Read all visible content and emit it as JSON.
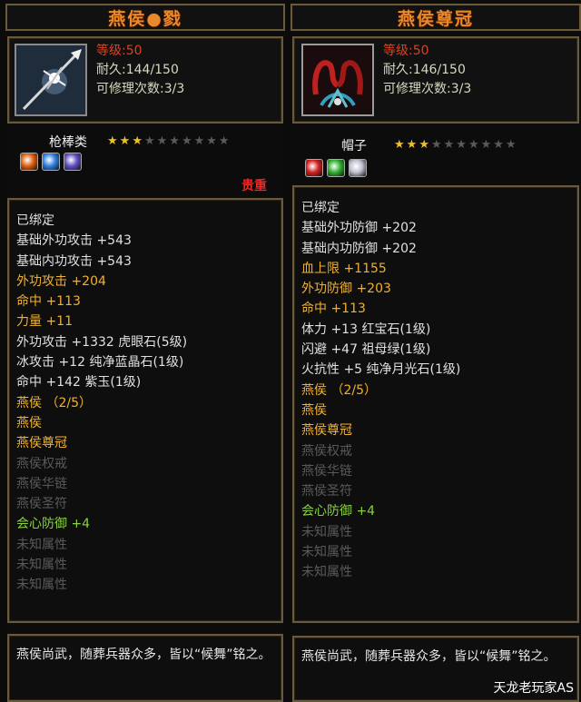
{
  "left": {
    "title": "燕侯●戮",
    "level": "等级:50",
    "durability": "耐久:144/150",
    "repair": "可修理次数:3/3",
    "type": "枪棒类",
    "stars_on": 3,
    "stars_total": 10,
    "gems": [
      {
        "name": "ruby-gem-icon",
        "color": "#e06010"
      },
      {
        "name": "sapphire-gem-icon",
        "color": "#3080e0"
      },
      {
        "name": "amethyst-gem-icon",
        "color": "#6050c0"
      }
    ],
    "rarity": "贵重",
    "attrs": [
      {
        "text": "已绑定",
        "color": "white"
      },
      {
        "text": "基础外功攻击 +543",
        "color": "white"
      },
      {
        "text": "基础内功攻击 +543",
        "color": "white"
      },
      {
        "text": "外功攻击 +204",
        "color": "orange"
      },
      {
        "text": "命中 +113",
        "color": "orange"
      },
      {
        "text": "力量 +11",
        "color": "orange"
      },
      {
        "text": "外功攻击 +1332 虎眼石(5级)",
        "color": "white"
      },
      {
        "text": "冰攻击 +12 纯净蓝晶石(1级)",
        "color": "white"
      },
      {
        "text": "命中 +142 紫玉(1级)",
        "color": "white"
      },
      {
        "text": "燕侯 （2/5）",
        "color": "orange"
      },
      {
        "text": "燕侯",
        "color": "orange"
      },
      {
        "text": "燕侯尊冠",
        "color": "orange"
      },
      {
        "text": "燕侯权戒",
        "color": "gray"
      },
      {
        "text": "燕侯华链",
        "color": "gray"
      },
      {
        "text": "燕侯圣符",
        "color": "gray"
      },
      {
        "text": "会心防御 +4",
        "color": "green"
      },
      {
        "text": "未知属性",
        "color": "gray"
      },
      {
        "text": "未知属性",
        "color": "gray"
      },
      {
        "text": "未知属性",
        "color": "gray"
      }
    ],
    "description": "燕侯尚武，随葬兵器众多，皆以“候舞”铭之。"
  },
  "right": {
    "title": "燕侯尊冠",
    "level": "等级:50",
    "durability": "耐久:146/150",
    "repair": "可修理次数:3/3",
    "type": "帽子",
    "stars_on": 3,
    "stars_total": 10,
    "gems": [
      {
        "name": "ruby-gem-icon",
        "color": "#d02020"
      },
      {
        "name": "emerald-gem-icon",
        "color": "#30b030"
      },
      {
        "name": "moonstone-gem-icon",
        "color": "#c0c0d0"
      }
    ],
    "attrs": [
      {
        "text": "已绑定",
        "color": "white"
      },
      {
        "text": "基础外功防御 +202",
        "color": "white"
      },
      {
        "text": "基础内功防御 +202",
        "color": "white"
      },
      {
        "text": "血上限 +1155",
        "color": "orange"
      },
      {
        "text": "外功防御 +203",
        "color": "orange"
      },
      {
        "text": "命中 +113",
        "color": "orange"
      },
      {
        "text": "体力 +13 红宝石(1级)",
        "color": "white"
      },
      {
        "text": "闪避 +47 祖母绿(1级)",
        "color": "white"
      },
      {
        "text": "火抗性 +5 纯净月光石(1级)",
        "color": "white"
      },
      {
        "text": "燕侯 （2/5）",
        "color": "orange"
      },
      {
        "text": "燕侯",
        "color": "orange"
      },
      {
        "text": "燕侯尊冠",
        "color": "orange"
      },
      {
        "text": "燕侯权戒",
        "color": "gray"
      },
      {
        "text": "燕侯华链",
        "color": "gray"
      },
      {
        "text": "燕侯圣符",
        "color": "gray"
      },
      {
        "text": "会心防御 +4",
        "color": "green"
      },
      {
        "text": "未知属性",
        "color": "gray"
      },
      {
        "text": "未知属性",
        "color": "gray"
      },
      {
        "text": "未知属性",
        "color": "gray"
      }
    ],
    "description": "燕侯尚武，随葬兵器众多，皆以“候舞”铭之。"
  },
  "watermark": "天龙老玩家AS"
}
